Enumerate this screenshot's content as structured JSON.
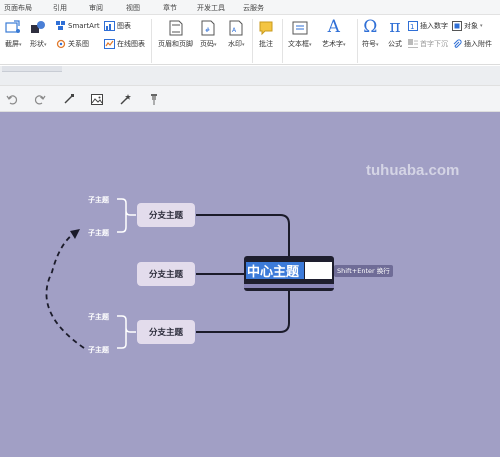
{
  "menu_tabs": [
    "页面布局",
    "引用",
    "审阅",
    "视图",
    "章节",
    "开发工具",
    "云服务"
  ],
  "ribbon": {
    "screenshot": "截屏",
    "shapes": "形状",
    "smartart": "SmartArt",
    "chart": "图表",
    "relation_diagram": "关系图",
    "online_chart": "在线图表",
    "header_footer": "页眉和页脚",
    "page_number": "页码",
    "watermark_btn": "水印",
    "comment": "批注",
    "textbox": "文本框",
    "art_text": "艺术字",
    "symbol": "符号",
    "formula": "公式",
    "insert_number": "插入数字",
    "object": "对象",
    "first_letter_sink": "首字下沉",
    "insert_attachment": "插入附件"
  },
  "mindmap": {
    "central_topic": "中心主题",
    "branches": [
      "分支主题",
      "分支主题",
      "分支主题"
    ],
    "subtopics": [
      "子主题",
      "子主题",
      "子主题",
      "子主题"
    ],
    "hint": "Shift+Enter 换行"
  },
  "watermark_text": "tuhuaba.com",
  "colors": {
    "canvas_bg": "#a19fc5",
    "branch_bg": "#e3dcec",
    "central_bg": "#1e1e2e",
    "selection": "#3d7bd9",
    "accent_blue": "#2f6fd6"
  }
}
